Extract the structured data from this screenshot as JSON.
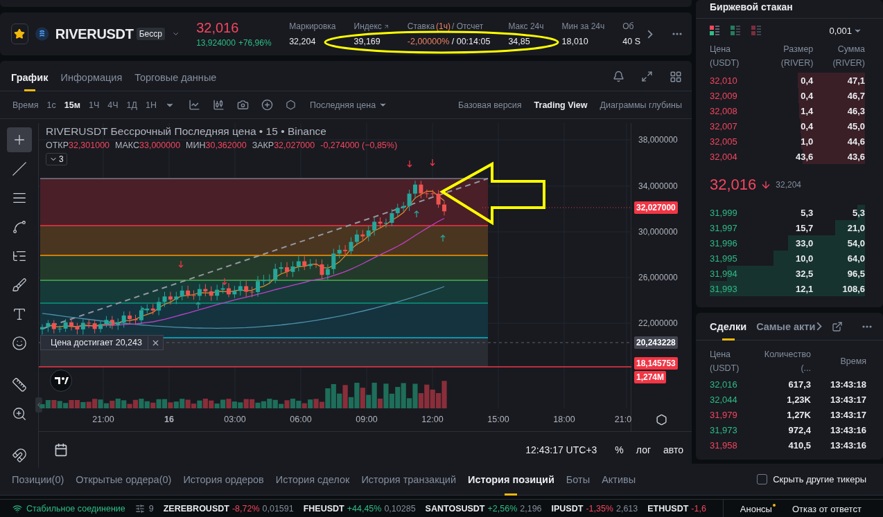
{
  "header": {
    "favorite": true,
    "symbol": "RIVERUSDT",
    "badge": "Бесср",
    "price": "32,016",
    "sub_price": "13,924000",
    "change": "+76,96%",
    "stats": [
      {
        "kind": "plain",
        "label": "Маркировка",
        "value": "32,204"
      },
      {
        "kind": "link",
        "label": "Индекс",
        "value": "39,169"
      },
      {
        "kind": "funding",
        "label": "Ставка",
        "label_accent": "(1ч)",
        "label_tail": "/ Отсчет",
        "value": "-2,00000%",
        "value_tail": "/ 00:14:05"
      },
      {
        "kind": "plain",
        "label": "Макс 24ч",
        "value": "34,85"
      },
      {
        "kind": "plain",
        "label": "Мин за 24ч",
        "value": "18,010"
      },
      {
        "kind": "plain",
        "label": "Об",
        "value": "40 S"
      }
    ]
  },
  "chart_panel": {
    "tabs": [
      {
        "label": "График",
        "selected": true
      },
      {
        "label": "Информация",
        "selected": false
      },
      {
        "label": "Торговые данные",
        "selected": false
      }
    ],
    "interval_label": "Время",
    "intervals": [
      {
        "label": "1с",
        "selected": false
      },
      {
        "label": "15м",
        "selected": true
      },
      {
        "label": "1Ч",
        "selected": false
      },
      {
        "label": "4Ч",
        "selected": false
      },
      {
        "label": "1Д",
        "selected": false
      },
      {
        "label": "1Н",
        "selected": false
      }
    ],
    "price_type": "Последняя цена",
    "views": [
      {
        "label": "Базовая версия",
        "selected": false
      },
      {
        "label": "Trading View",
        "selected": true
      },
      {
        "label": "Диаграммы глубины",
        "selected": false
      }
    ],
    "tools": [
      {
        "kind": "crosshair",
        "selected": true
      },
      {
        "kind": "line",
        "selected": false
      },
      {
        "kind": "lines",
        "selected": false
      },
      {
        "kind": "pattern",
        "selected": false
      },
      {
        "kind": "fib",
        "selected": false
      },
      {
        "kind": "brush",
        "selected": false
      },
      {
        "kind": "text",
        "selected": false
      },
      {
        "kind": "emoji",
        "selected": false
      },
      {
        "kind": "ruler",
        "selected": false
      },
      {
        "kind": "zoom",
        "selected": false
      },
      {
        "kind": "magnet",
        "selected": false
      }
    ],
    "chart": {
      "title": "RIVERUSDT Бессрочный Последняя цена • 15 • Binance",
      "ohlc": [
        {
          "label": "ОТКР",
          "value": "32,301000"
        },
        {
          "label": "МАКС",
          "value": "33,000000"
        },
        {
          "label": "МИН",
          "value": "30,362000"
        },
        {
          "label": "ЗАКР",
          "value": "32,027000"
        }
      ],
      "change": "-0,274000 (−0,85%)",
      "collapsed_count": "3",
      "alert": "Цена достигает 20,243",
      "y_ticks": [
        "38,000000",
        "34,000000",
        "30,000000",
        "26,000000",
        "22,000000"
      ],
      "price_tags": [
        {
          "kind": "last",
          "value": "32,027000"
        },
        {
          "kind": "alert",
          "value": "20,243228"
        },
        {
          "kind": "line",
          "value": "18,145753"
        },
        {
          "kind": "volume",
          "value": "1,274M"
        }
      ],
      "x_ticks": [
        {
          "label": "21:00",
          "bold": false
        },
        {
          "label": "16",
          "bold": true
        },
        {
          "label": "03:00",
          "bold": false
        },
        {
          "label": "06:00",
          "bold": false
        },
        {
          "label": "09:00",
          "bold": false
        },
        {
          "label": "12:00",
          "bold": false
        },
        {
          "label": "15:00",
          "bold": false
        },
        {
          "label": "18:00",
          "bold": false
        },
        {
          "label": "21:0",
          "bold": false
        }
      ],
      "clock": "12:43:17 UTC+3",
      "scale_buttons": [
        "%",
        "лог",
        "авто"
      ]
    }
  },
  "order_book": {
    "title": "Биржевой стакан",
    "step": "0,001",
    "views": [
      {
        "kind": "both",
        "selected": true
      },
      {
        "kind": "bids",
        "selected": false
      },
      {
        "kind": "asks",
        "selected": false
      }
    ],
    "columns": [
      {
        "label": "Цена",
        "unit": "(USDT)"
      },
      {
        "label": "Размер",
        "unit": "(RIVER)"
      },
      {
        "label": "Сумма",
        "unit": "(RIVER)"
      }
    ],
    "asks": [
      {
        "price": "32,010",
        "size": "0,4",
        "total": "47,1"
      },
      {
        "price": "32,009",
        "size": "0,4",
        "total": "46,7"
      },
      {
        "price": "32,008",
        "size": "1,4",
        "total": "46,3"
      },
      {
        "price": "32,007",
        "size": "0,4",
        "total": "45,0"
      },
      {
        "price": "32,005",
        "size": "1,0",
        "total": "44,6"
      },
      {
        "price": "32,004",
        "size": "43,6",
        "total": "43,6"
      }
    ],
    "last_price": "32,016",
    "mark_price": "32,204",
    "bids": [
      {
        "price": "31,999",
        "size": "5,3",
        "total": "5,3"
      },
      {
        "price": "31,997",
        "size": "15,7",
        "total": "21,0"
      },
      {
        "price": "31,996",
        "size": "33,0",
        "total": "54,0"
      },
      {
        "price": "31,995",
        "size": "10,0",
        "total": "64,0"
      },
      {
        "price": "31,994",
        "size": "32,5",
        "total": "96,5"
      },
      {
        "price": "31,993",
        "size": "12,1",
        "total": "108,6"
      }
    ]
  },
  "trades": {
    "tabs": [
      {
        "label": "Сделки",
        "selected": true
      },
      {
        "label": "Самые акти",
        "selected": false
      }
    ],
    "columns": [
      {
        "label": "Цена",
        "unit": "(USDT)"
      },
      {
        "label": "Количество (..."
      },
      {
        "label": "Время"
      }
    ],
    "rows": [
      {
        "price": "32,016",
        "qty": "617,3",
        "time": "13:43:18",
        "color": "#2ebd85"
      },
      {
        "price": "32,044",
        "qty": "1,23K",
        "time": "13:43:17",
        "color": "#2ebd85"
      },
      {
        "price": "31,979",
        "qty": "1,27K",
        "time": "13:43:17",
        "color": "#f6465d"
      },
      {
        "price": "31,973",
        "qty": "972,4",
        "time": "13:43:16",
        "color": "#2ebd85"
      },
      {
        "price": "31,958",
        "qty": "410,5",
        "time": "13:43:16",
        "color": "#f6465d"
      }
    ]
  },
  "bottom_tabs": [
    {
      "label": "Позиции(0)",
      "selected": false
    },
    {
      "label": "Открытые ордера(0)",
      "selected": false
    },
    {
      "label": "История ордеров",
      "selected": false
    },
    {
      "label": "История сделок",
      "selected": false
    },
    {
      "label": "История транзакций",
      "selected": false
    },
    {
      "label": "История позиций",
      "selected": true
    },
    {
      "label": "Боты",
      "selected": false
    },
    {
      "label": "Активы",
      "selected": false
    }
  ],
  "hide_tickers": {
    "label": "Скрыть другие тикеры",
    "checked": false
  },
  "status_bar": {
    "connection": "Стабильное соединение",
    "filter_count": "9",
    "tickers": [
      {
        "symbol": "ZEREBROUSDT",
        "change": "-8,72%",
        "price": "0,01591",
        "color": "#f6465d"
      },
      {
        "symbol": "FHEUSDT",
        "change": "+44,45%",
        "price": "0,10285",
        "color": "#2ebd85"
      },
      {
        "symbol": "SANTOSUSDT",
        "change": "+2,56%",
        "price": "2,196",
        "color": "#2ebd85"
      },
      {
        "symbol": "IPUSDT",
        "change": "-1,35%",
        "price": "2,613",
        "color": "#f6465d"
      },
      {
        "symbol": "ETHUSDT",
        "change": "-1,6",
        "color": "#f6465d"
      }
    ],
    "links": [
      {
        "label": "Анонсы",
        "dot": true
      },
      {
        "label": "Отказ от ответст",
        "dot": false
      }
    ]
  }
}
